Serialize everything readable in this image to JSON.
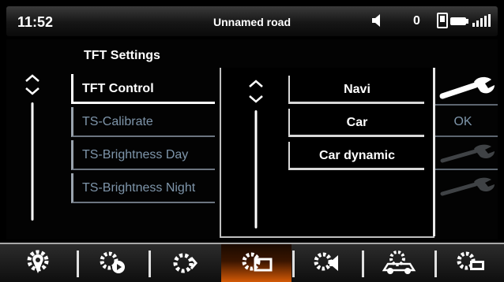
{
  "status": {
    "time": "11:52",
    "road": "Unnamed road",
    "speaker_icon": "speaker-icon",
    "count": "0",
    "phone_icon": "phone-icon",
    "battery_icon": "battery-icon",
    "signal_icon": "signal-icon"
  },
  "settings": {
    "title": "TFT Settings",
    "items": [
      {
        "label": "TFT Control"
      },
      {
        "label": "TS-Calibrate"
      },
      {
        "label": "TS-Brightness Day"
      },
      {
        "label": "TS-Brightness Night"
      }
    ]
  },
  "submenu": {
    "options": [
      {
        "label": "Navi"
      },
      {
        "label": "Car"
      },
      {
        "label": "Car dynamic"
      }
    ]
  },
  "right": {
    "ok_label": "OK"
  },
  "tabs": [
    {
      "icon": "map-pin-gear-icon"
    },
    {
      "icon": "gear-play-icon"
    },
    {
      "icon": "gear-arrows-icon"
    },
    {
      "icon": "gear-screen-icon",
      "active": true
    },
    {
      "icon": "gear-speaker-icon"
    },
    {
      "icon": "car-gear-icon"
    },
    {
      "icon": "gear-window-icon"
    }
  ],
  "colors": {
    "accent": "#d45a06",
    "dim_text": "#7e95aa"
  }
}
